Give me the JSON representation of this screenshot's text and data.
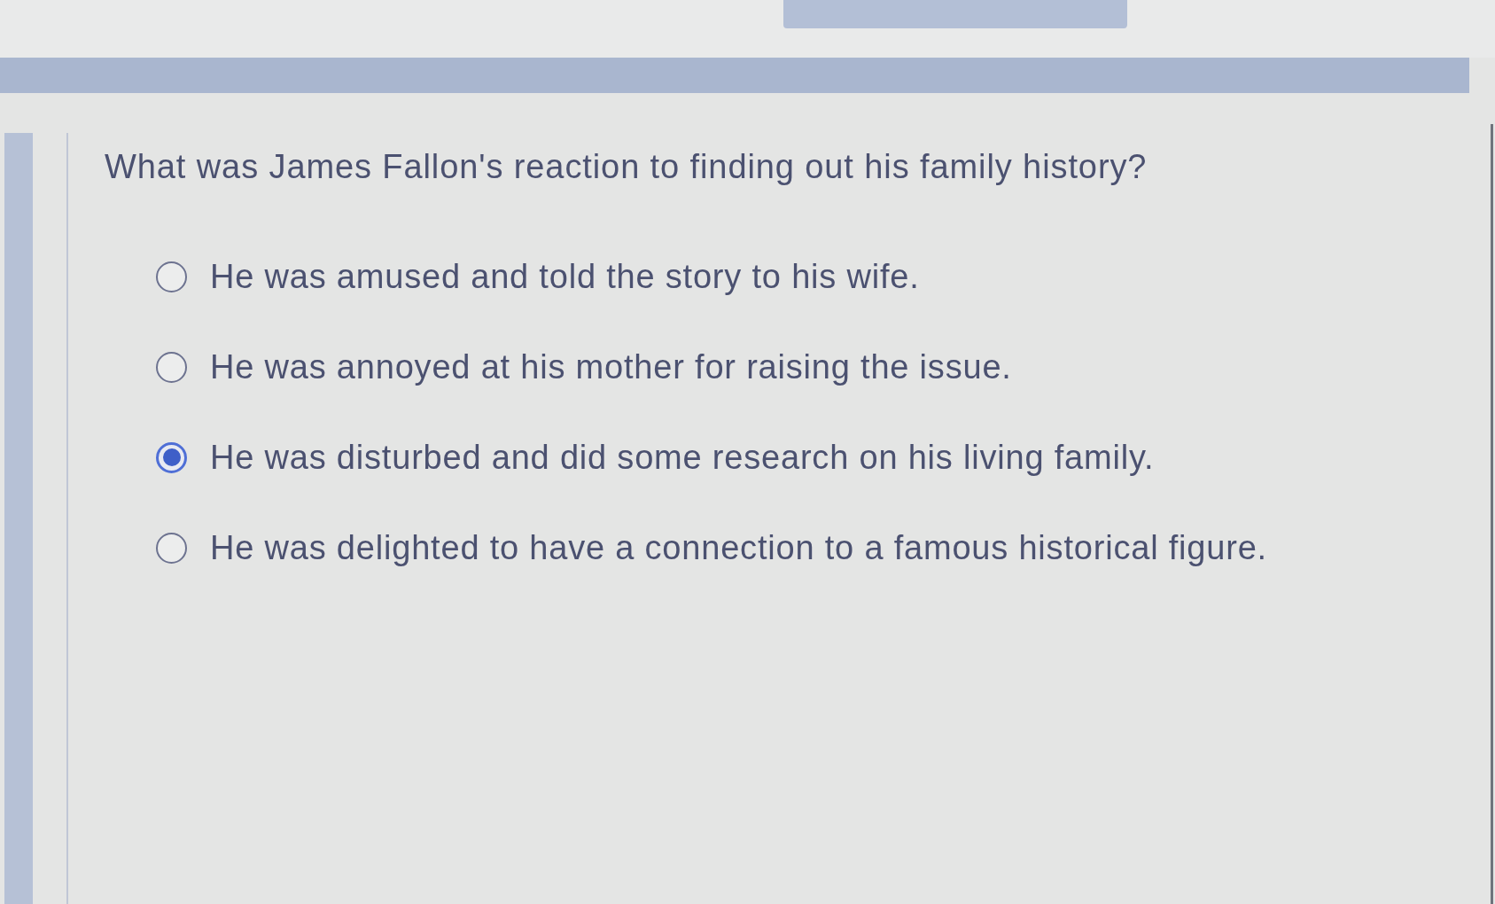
{
  "question": {
    "text": "What was James Fallon's reaction to finding out his family history?"
  },
  "options": [
    {
      "label": "He was amused and told the story to his wife.",
      "selected": false
    },
    {
      "label": "He was annoyed at his mother for raising the issue.",
      "selected": false
    },
    {
      "label": "He was disturbed and did some research on his living family.",
      "selected": true
    },
    {
      "label": "He was delighted to have a connection to a famous historical figure.",
      "selected": false
    }
  ]
}
